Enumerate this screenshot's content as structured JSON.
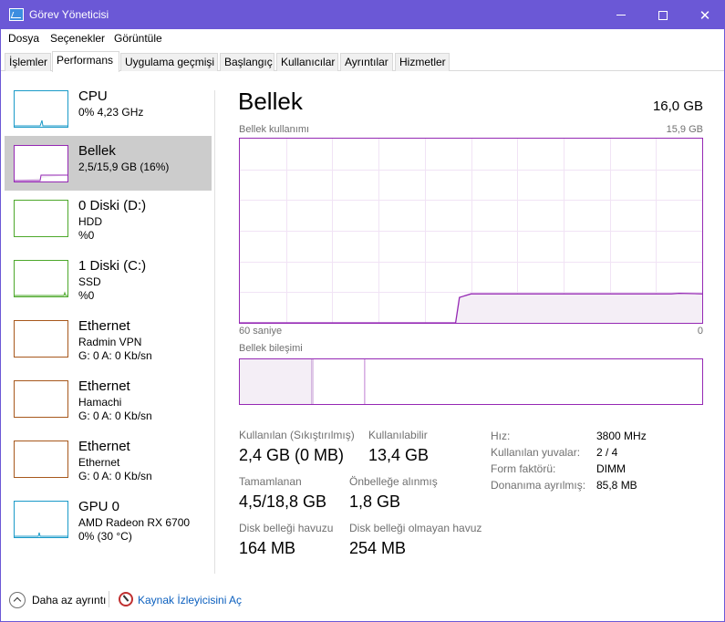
{
  "window": {
    "title": "Görev Yöneticisi"
  },
  "menu": [
    "Dosya",
    "Seçenekler",
    "Görüntüle"
  ],
  "tabs": [
    "İşlemler",
    "Performans",
    "Uygulama geçmişi",
    "Başlangıç",
    "Kullanıcılar",
    "Ayrıntılar",
    "Hizmetler"
  ],
  "active_tab": "Performans",
  "sidebar": [
    {
      "name": "CPU",
      "line1": "0% 4,23 GHz",
      "line2": "",
      "color": "#1a9ac8"
    },
    {
      "name": "Bellek",
      "line1": "2,5/15,9 GB (16%)",
      "line2": "",
      "color": "#9528b4",
      "fill_fraction": 0.16
    },
    {
      "name": "0 Diski (D:)",
      "line1": "HDD",
      "line2": "%0",
      "color": "#4da82b"
    },
    {
      "name": "1 Diski (C:)",
      "line1": "SSD",
      "line2": "%0",
      "color": "#4da82b"
    },
    {
      "name": "Ethernet",
      "line1": "Radmin VPN",
      "line2": "G: 0 A: 0 Kb/sn",
      "color": "#a7581c"
    },
    {
      "name": "Ethernet",
      "line1": "Hamachi",
      "line2": "G: 0 A: 0 Kb/sn",
      "color": "#a7581c"
    },
    {
      "name": "Ethernet",
      "line1": "Ethernet",
      "line2": "G: 0 A: 0 Kb/sn",
      "color": "#a7581c"
    },
    {
      "name": "GPU 0",
      "line1": "AMD Radeon RX 6700",
      "line2": "0% (30 °C)",
      "color": "#1a9ac8"
    }
  ],
  "main": {
    "title": "Bellek",
    "total": "16,0 GB",
    "usage_label": "Bellek kullanımı",
    "usage_max": "15,9 GB",
    "time_left": "60 saniye",
    "time_right": "0",
    "composition_label": "Bellek bileşimi",
    "stats": {
      "in_use_label": "Kullanılan (Sıkıştırılmış)",
      "in_use_value": "2,4 GB (0 MB)",
      "available_label": "Kullanılabilir",
      "available_value": "13,4 GB",
      "committed_label": "Tamamlanan",
      "committed_value": "4,5/18,8 GB",
      "cached_label": "Önbelleğe alınmış",
      "cached_value": "1,8 GB",
      "paged_label": "Disk belleği havuzu",
      "paged_value": "164 MB",
      "nonpaged_label": "Disk belleği olmayan havuz",
      "nonpaged_value": "254 MB"
    },
    "details": [
      {
        "label": "Hız:",
        "value": "3800 MHz"
      },
      {
        "label": "Kullanılan yuvalar:",
        "value": "2 / 4"
      },
      {
        "label": "Form faktörü:",
        "value": "DIMM"
      },
      {
        "label": "Donanıma ayrılmış:",
        "value": "85,8 MB"
      }
    ]
  },
  "chart_data": {
    "type": "area",
    "title": "Bellek kullanımı",
    "xlabel": "",
    "ylabel": "",
    "x_range_seconds": [
      60,
      0
    ],
    "ylim_gb": [
      0,
      15.9
    ],
    "grid": true,
    "series": [
      {
        "name": "",
        "x": [
          60,
          32,
          31.5,
          30,
          20,
          10,
          4,
          3,
          0
        ],
        "y": [
          0,
          0,
          2.2,
          2.5,
          2.5,
          2.5,
          2.5,
          2.55,
          2.5
        ]
      }
    ]
  },
  "composition": {
    "in_use_fraction": 0.155,
    "modified_fraction": 0.005,
    "standby_fraction": 0.11
  },
  "footer": {
    "fewer_details": "Daha az ayrıntı",
    "open_monitor": "Kaynak İzleyicisini Aç"
  }
}
